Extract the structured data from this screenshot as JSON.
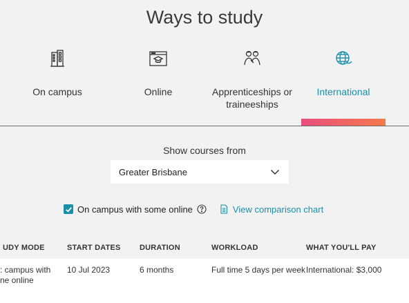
{
  "page": {
    "title": "Ways to study"
  },
  "tabs": [
    {
      "label": "On campus",
      "icon": "building-icon"
    },
    {
      "label": "Online",
      "icon": "online-course-icon"
    },
    {
      "label": "Apprenticeships or traineeships",
      "icon": "apprentices-icon"
    },
    {
      "label": "International",
      "icon": "globe-icon",
      "active": true
    }
  ],
  "filter": {
    "label": "Show courses from",
    "selected": "Greater Brisbane"
  },
  "options": {
    "checkbox_label": "On campus with some online",
    "checked": true,
    "comparison_link": "View comparison chart"
  },
  "table": {
    "headers": [
      "UDY MODE",
      "START DATES",
      "DURATION",
      "WORKLOAD",
      "WHAT YOU'LL PAY"
    ],
    "rows": [
      {
        "mode_line1": ": campus with",
        "mode_line2": "ne online",
        "start": "10 Jul 2023",
        "duration": "6 months",
        "workload": "Full time 5 days per week",
        "pay": "International: $3,000"
      }
    ]
  },
  "colors": {
    "accent": "#1a8fa8",
    "indicator_start": "#e94e7f",
    "indicator_end": "#f47a4a"
  }
}
